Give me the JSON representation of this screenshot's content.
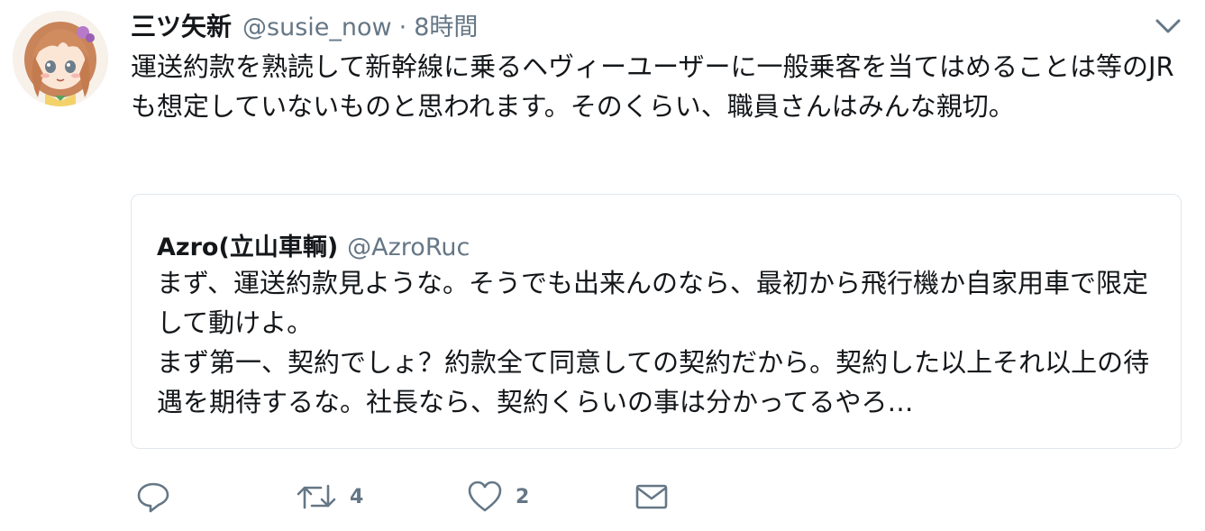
{
  "tweet": {
    "display_name": "三ツ矢新",
    "handle": "@susie_now",
    "separator": "·",
    "timestamp": "8時間",
    "text": "運送約款を熟読して新幹線に乗るヘヴィーユーザーに一般乗客を当てはめることは等のJRも想定していないものと思われます。そのくらい、職員さんはみんな親切。"
  },
  "quoted": {
    "display_name": "Azro(立山車輌)",
    "handle": "@AzroRuc",
    "text": "まず、運送約款見ような。そうでも出来んのなら、最初から飛行機か自家用車で限定して動けよ。\nまず第一、契約でしょ？約款全て同意しての契約だから。契約した以上それ以上の待遇を期待するな。社長なら、契約くらいの事は分かってるやろ…"
  },
  "actions": {
    "reply_icon": "reply-icon",
    "retweet_icon": "retweet-icon",
    "retweet_count": "4",
    "like_icon": "heart-icon",
    "like_count": "2",
    "dm_icon": "envelope-icon"
  },
  "colors": {
    "text": "#14171a",
    "secondary": "#657786",
    "border": "#e1e8ed"
  }
}
